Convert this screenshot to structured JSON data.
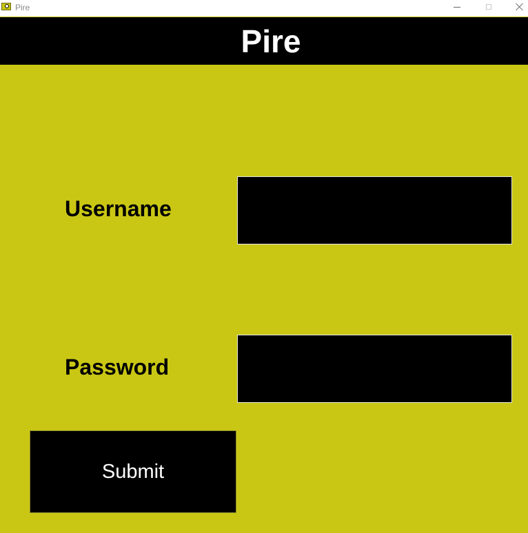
{
  "window": {
    "title": "Pire",
    "icon": "app-icon",
    "controls": [
      "minimize-icon",
      "maximize-icon",
      "close-icon"
    ]
  },
  "header": {
    "title": "Pire"
  },
  "form": {
    "username_label": "Username",
    "username_value": "",
    "password_label": "Password",
    "password_value": "",
    "submit_label": "Submit"
  },
  "colors": {
    "background": "#c9c714",
    "header": "#000000",
    "input": "#000000",
    "button": "#000000",
    "text_light": "#ffffff",
    "text_dark": "#000000"
  }
}
